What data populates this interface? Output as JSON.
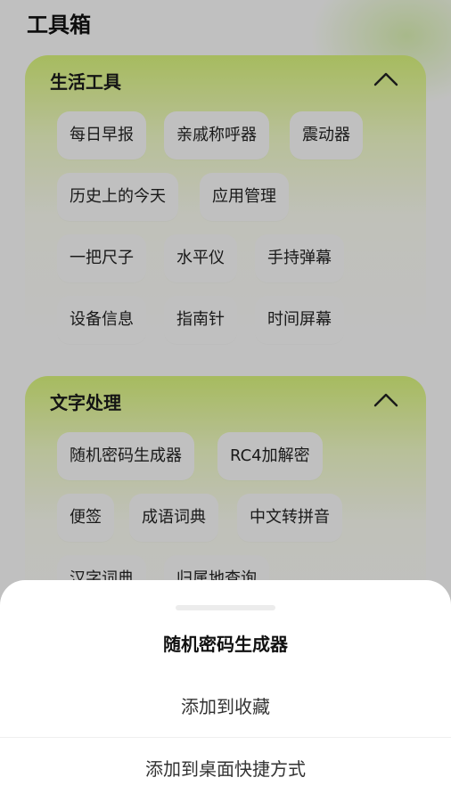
{
  "page": {
    "title": "工具箱"
  },
  "sections": [
    {
      "title": "生活工具",
      "collapse_icon": "chevron-up-icon",
      "tools": [
        "每日早报",
        "亲戚称呼器",
        "震动器",
        "历史上的今天",
        "应用管理",
        "一把尺子",
        "水平仪",
        "手持弹幕",
        "设备信息",
        "指南针",
        "时间屏幕"
      ]
    },
    {
      "title": "文字处理",
      "collapse_icon": "chevron-up-icon",
      "tools": [
        "随机密码生成器",
        "RC4加解密",
        "便签",
        "成语词典",
        "中文转拼音",
        "汉字词典",
        "归属地查询"
      ]
    }
  ],
  "sheet": {
    "title": "随机密码生成器",
    "options": [
      "添加到收藏",
      "添加到桌面快捷方式"
    ]
  }
}
